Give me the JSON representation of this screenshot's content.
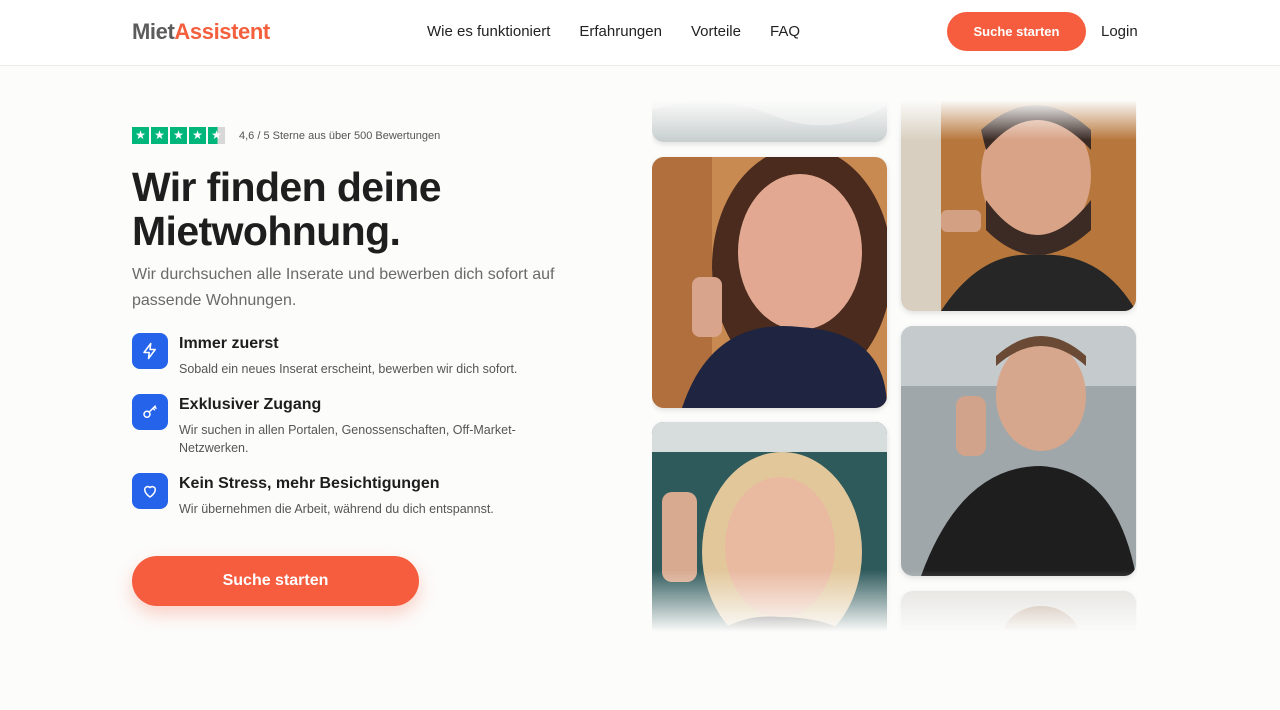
{
  "header": {
    "logo_part1": "Miet",
    "logo_part2": "Assistent",
    "nav": [
      "Wie es funktioniert",
      "Erfahrungen",
      "Vorteile",
      "FAQ"
    ],
    "cta_label": "Suche starten",
    "login_label": "Login"
  },
  "rating": {
    "stars": 4.6,
    "text": "4,6 / 5 Sterne aus über 500 Bewertungen"
  },
  "hero": {
    "headline_line1": "Wir finden deine",
    "headline_line2": "Mietwohnung.",
    "subtitle": "Wir durchsuchen alle Inserate und bewerben dich sofort auf passende Wohnungen."
  },
  "features": [
    {
      "icon": "lightning-icon",
      "title": "Immer zuerst",
      "desc": "Sobald ein neues Inserat erscheint, bewerben wir dich sofort."
    },
    {
      "icon": "key-icon",
      "title": "Exklusiver Zugang",
      "desc": "Wir suchen in allen Portalen, Genossenschaften, Off-Market-Netzwerken."
    },
    {
      "icon": "heart-icon",
      "title": "Kein Stress, mehr Besichtigungen",
      "desc": "Wir übernehmen die Arbeit, während du dich entspannst."
    }
  ],
  "main_cta_label": "Suche starten",
  "colors": {
    "accent": "#f55d3e",
    "brand_gray": "#5c5c5c",
    "feature_blue": "#2563eb",
    "trustpilot_green": "#00b67a"
  }
}
